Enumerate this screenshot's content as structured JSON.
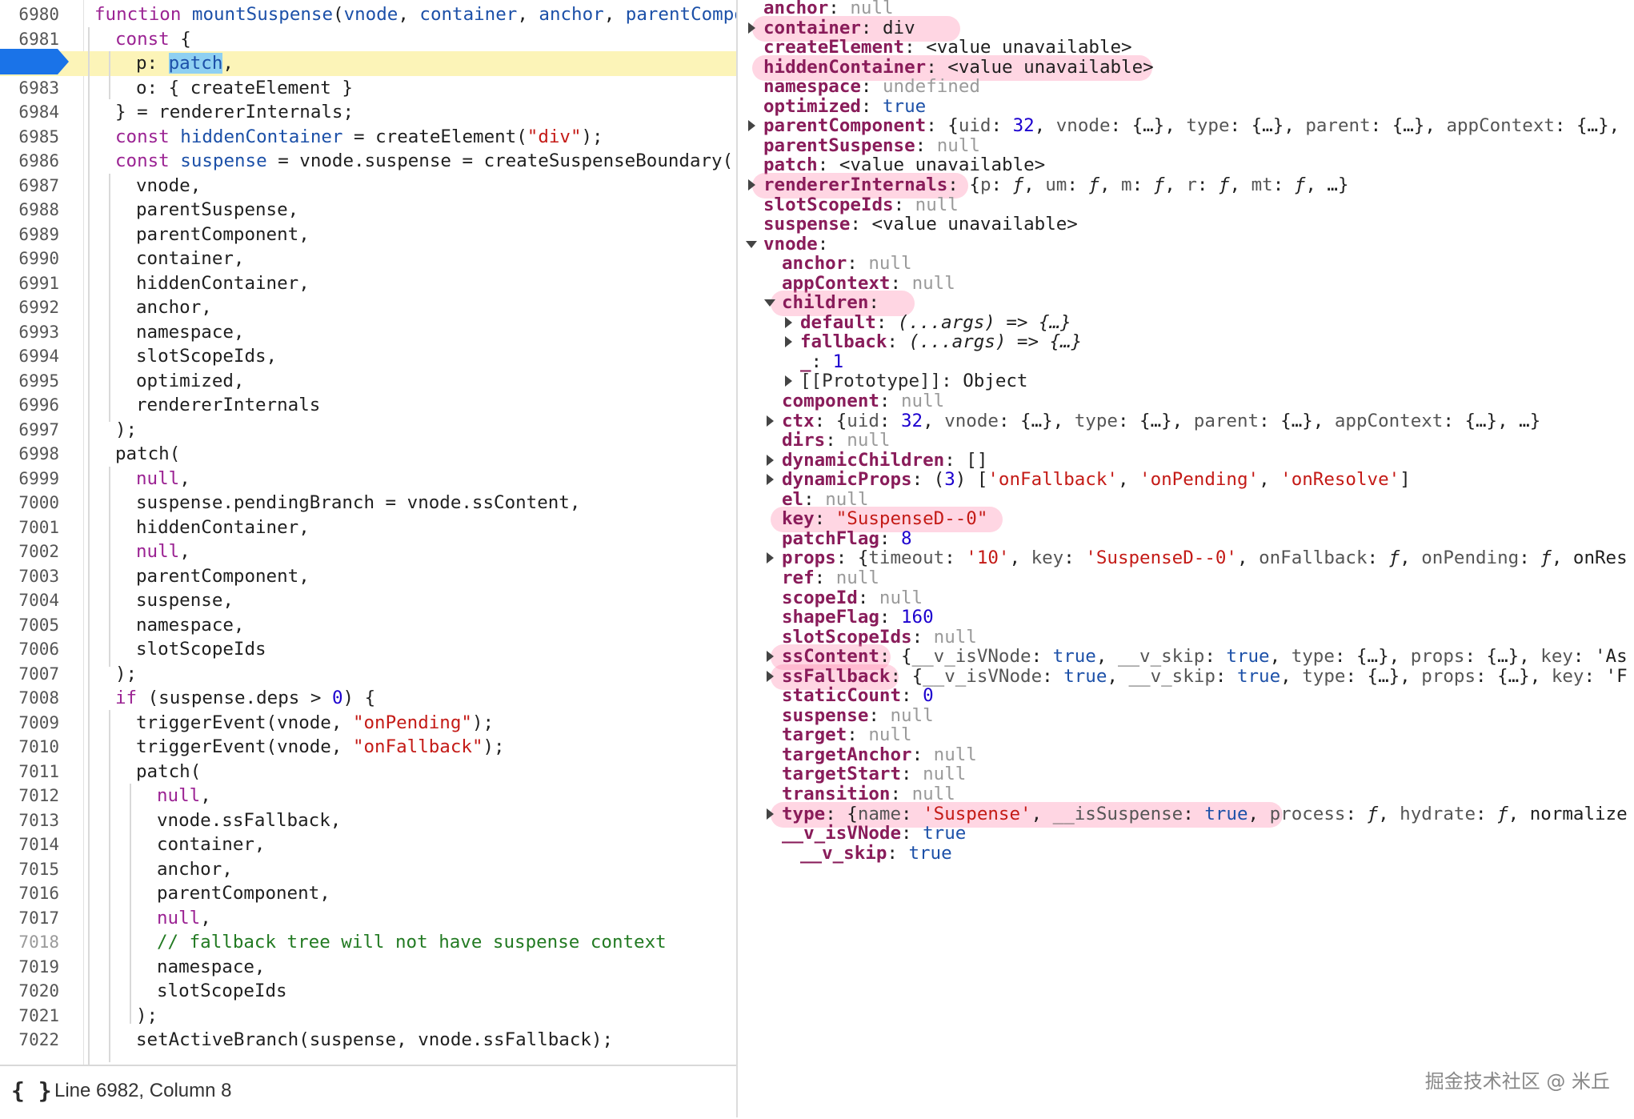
{
  "editor": {
    "current_line": 6982,
    "lines": [
      {
        "no": 6980,
        "text": "function mountSuspense(vnode, container, anchor, parentCompor"
      },
      {
        "no": 6981,
        "text": "const {"
      },
      {
        "no": 6982,
        "text": "p: patch,"
      },
      {
        "no": 6983,
        "text": "o: { createElement }"
      },
      {
        "no": 6984,
        "text": "} = rendererInternals;"
      },
      {
        "no": 6985,
        "text": "const hiddenContainer = createElement(\"div\");"
      },
      {
        "no": 6986,
        "text": "const suspense = vnode.suspense = createSuspenseBoundary("
      },
      {
        "no": 6987,
        "text": "vnode,"
      },
      {
        "no": 6988,
        "text": "parentSuspense,"
      },
      {
        "no": 6989,
        "text": "parentComponent,"
      },
      {
        "no": 6990,
        "text": "container,"
      },
      {
        "no": 6991,
        "text": "hiddenContainer,"
      },
      {
        "no": 6992,
        "text": "anchor,"
      },
      {
        "no": 6993,
        "text": "namespace,"
      },
      {
        "no": 6994,
        "text": "slotScopeIds,"
      },
      {
        "no": 6995,
        "text": "optimized,"
      },
      {
        "no": 6996,
        "text": "rendererInternals"
      },
      {
        "no": 6997,
        "text": ");"
      },
      {
        "no": 6998,
        "text": "patch("
      },
      {
        "no": 6999,
        "text": "null,"
      },
      {
        "no": 7000,
        "text": "suspense.pendingBranch = vnode.ssContent,"
      },
      {
        "no": 7001,
        "text": "hiddenContainer,"
      },
      {
        "no": 7002,
        "text": "null,"
      },
      {
        "no": 7003,
        "text": "parentComponent,"
      },
      {
        "no": 7004,
        "text": "suspense,"
      },
      {
        "no": 7005,
        "text": "namespace,"
      },
      {
        "no": 7006,
        "text": "slotScopeIds"
      },
      {
        "no": 7007,
        "text": ");"
      },
      {
        "no": 7008,
        "text": "if (suspense.deps > 0) {"
      },
      {
        "no": 7009,
        "text": "triggerEvent(vnode, \"onPending\");"
      },
      {
        "no": 7010,
        "text": "triggerEvent(vnode, \"onFallback\");"
      },
      {
        "no": 7011,
        "text": "patch("
      },
      {
        "no": 7012,
        "text": "null,"
      },
      {
        "no": 7013,
        "text": "vnode.ssFallback,"
      },
      {
        "no": 7014,
        "text": "container,"
      },
      {
        "no": 7015,
        "text": "anchor,"
      },
      {
        "no": 7016,
        "text": "parentComponent,"
      },
      {
        "no": 7017,
        "text": "null,"
      },
      {
        "no": 7018,
        "text": "// fallback tree will not have suspense context"
      },
      {
        "no": 7019,
        "text": "namespace,"
      },
      {
        "no": 7020,
        "text": "slotScopeIds"
      },
      {
        "no": 7021,
        "text": ");"
      },
      {
        "no": 7022,
        "text": "setActiveBranch(suspense, vnode.ssFallback);"
      }
    ],
    "status": {
      "icon": "curly-braces-icon",
      "cursor_text": "Line 6982, Column 8"
    }
  },
  "scope": {
    "items": [
      {
        "key": "anchor",
        "value": "null"
      },
      {
        "key": "container",
        "value": "div"
      },
      {
        "key": "createElement",
        "value": "<value unavailable>"
      },
      {
        "key": "hiddenContainer",
        "value": "<value unavailable>"
      },
      {
        "key": "namespace",
        "value": "undefined"
      },
      {
        "key": "optimized",
        "value": "true"
      },
      {
        "key": "parentComponent",
        "value": "{uid: 32, vnode: {…}, type: {…}, parent: {…}, appContext: {…},"
      },
      {
        "key": "parentSuspense",
        "value": "null"
      },
      {
        "key": "patch",
        "value": "<value unavailable>"
      },
      {
        "key": "rendererInternals",
        "value": "{p: ƒ, um: ƒ, m: ƒ, r: ƒ, mt: ƒ, …}"
      },
      {
        "key": "slotScopeIds",
        "value": "null"
      },
      {
        "key": "suspense",
        "value": "<value unavailable>"
      },
      {
        "key": "vnode",
        "value": ""
      },
      {
        "key": "anchor",
        "value": "null"
      },
      {
        "key": "appContext",
        "value": "null"
      },
      {
        "key": "children",
        "value": ""
      },
      {
        "key": "default",
        "value": "(...args) => {…}"
      },
      {
        "key": "fallback",
        "value": "(...args) => {…}"
      },
      {
        "key": "_",
        "value": "1"
      },
      {
        "key": "[[Prototype]]",
        "value": "Object"
      },
      {
        "key": "component",
        "value": "null"
      },
      {
        "key": "ctx",
        "value": "{uid: 32, vnode: {…}, type: {…}, parent: {…}, appContext: {…}, …}"
      },
      {
        "key": "dirs",
        "value": "null"
      },
      {
        "key": "dynamicChildren",
        "value": "[]"
      },
      {
        "key": "dynamicProps",
        "value": "(3) ['onFallback', 'onPending', 'onResolve']"
      },
      {
        "key": "el",
        "value": "null"
      },
      {
        "key": "key",
        "value": "\"SuspenseD--0\""
      },
      {
        "key": "patchFlag",
        "value": "8"
      },
      {
        "key": "props",
        "value": "{timeout: '10', key: 'SuspenseD--0', onFallback: ƒ, onPending: ƒ, onRes"
      },
      {
        "key": "ref",
        "value": "null"
      },
      {
        "key": "scopeId",
        "value": "null"
      },
      {
        "key": "shapeFlag",
        "value": "160"
      },
      {
        "key": "slotScopeIds",
        "value": "null"
      },
      {
        "key": "ssContent",
        "value": "{__v_isVNode: true, __v_skip: true, type: {…}, props: {…}, key: 'As"
      },
      {
        "key": "ssFallback",
        "value": "{__v_isVNode: true, __v_skip: true, type: {…}, props: {…}, key: 'F"
      },
      {
        "key": "staticCount",
        "value": "0"
      },
      {
        "key": "suspense",
        "value": "null"
      },
      {
        "key": "target",
        "value": "null"
      },
      {
        "key": "targetAnchor",
        "value": "null"
      },
      {
        "key": "targetStart",
        "value": "null"
      },
      {
        "key": "transition",
        "value": "null"
      },
      {
        "key": "type",
        "value": "{name: 'Suspense', __isSuspense: true, process: ƒ, hydrate: ƒ, normalize"
      },
      {
        "key": "__v_isVNode",
        "value": "true"
      },
      {
        "key": "__v_skip",
        "value": "true"
      }
    ],
    "highlighted": [
      "container",
      "hiddenContainer",
      "rendererInternals",
      "children",
      "key",
      "ssContent",
      "ssFallback",
      "type"
    ]
  },
  "watermark": "掘金技术社区 @ 米丘",
  "colors": {
    "keyword": "#9b2393",
    "variable": "#1c50a8",
    "string": "#c41a16",
    "comment": "#227a22",
    "property_key": "#891c5a",
    "current_line_bg": "#fcf4b8",
    "breakpoint": "#1a73e8",
    "annotation_highlight": "#ff80a8"
  }
}
